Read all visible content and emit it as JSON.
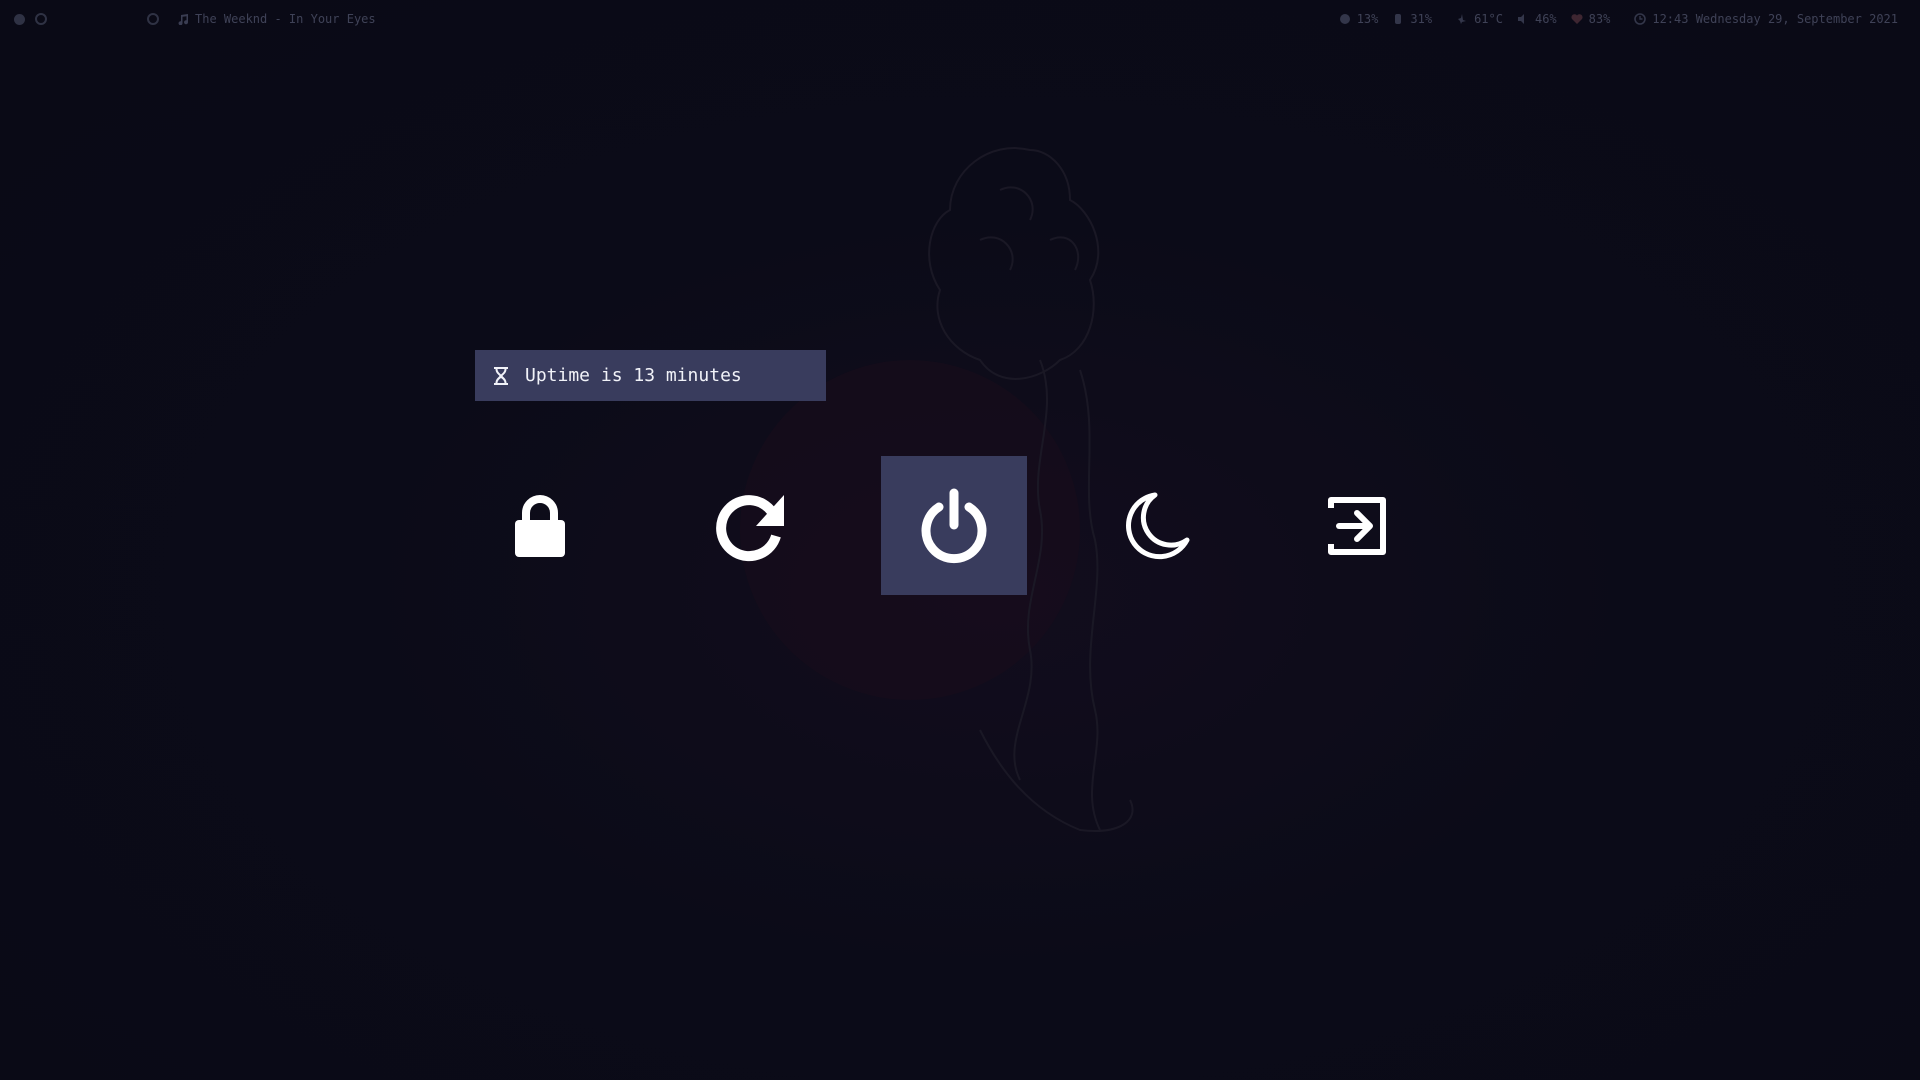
{
  "topbar": {
    "now_playing": "The Weeknd - In Your Eyes",
    "cpu": "13%",
    "memory": "31%",
    "temperature": "61°C",
    "volume": "46%",
    "battery": "83%",
    "clock": "12:43 Wednesday 29, September 2021"
  },
  "uptime": {
    "text": "Uptime is 13 minutes"
  },
  "menu": {
    "options": [
      "lock",
      "reboot",
      "shutdown",
      "suspend",
      "logout"
    ],
    "selected": "shutdown"
  },
  "colors": {
    "background": "#0b0b18",
    "selection": "#393c5d",
    "foreground": "#ffffff"
  }
}
